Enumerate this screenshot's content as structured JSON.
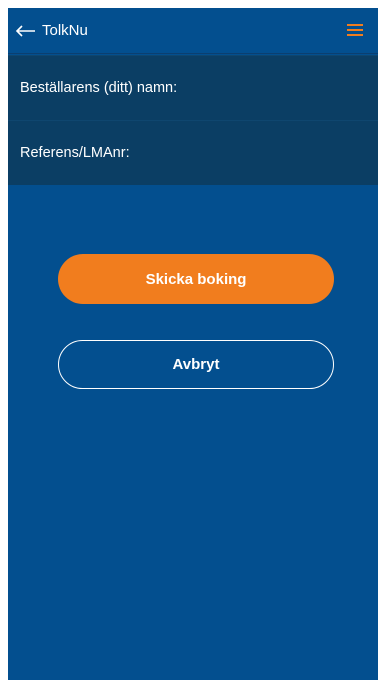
{
  "app_bar": {
    "back_icon": "arrow-left-icon",
    "title": "TolkNu",
    "menu_icon": "hamburger-menu-icon",
    "menu_icon_color": "#f17d1e"
  },
  "form": {
    "orderer_name_label": "Beställarens (ditt) namn:",
    "orderer_name_value": "",
    "reference_label": "Referens/LMAnr:",
    "reference_value": ""
  },
  "actions": {
    "send_label": "Skicka boking",
    "cancel_label": "Avbryt"
  },
  "colors": {
    "background": "#034f8f",
    "field_background": "#0b3e64",
    "accent": "#f17d1e",
    "text": "#ffffff"
  }
}
